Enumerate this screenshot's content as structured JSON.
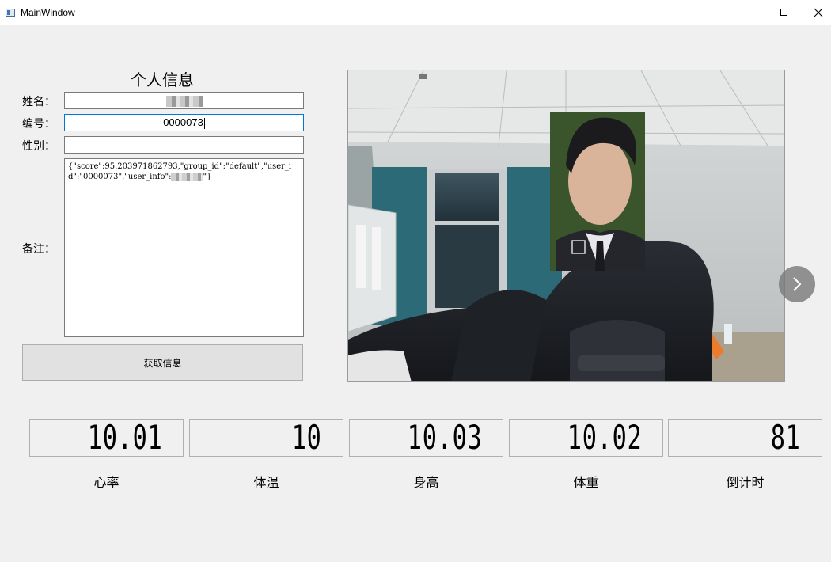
{
  "window": {
    "title": "MainWindow"
  },
  "form": {
    "title": "个人信息",
    "name_label": "姓名：",
    "id_label": "编号：",
    "id_value": "0000073",
    "gender_label": "性别：",
    "gender_value": "",
    "notes_label": "备注：",
    "notes_text_part1": "{\"score\":95.203971862793,\"group_id\":\"default\",\"user_id\":\"0000073\",\"user_info\":",
    "notes_text_part2": "\"}",
    "get_button": "获取信息"
  },
  "metrics": [
    {
      "label": "心率",
      "value": "10.01"
    },
    {
      "label": "体温",
      "value": "10"
    },
    {
      "label": "身高",
      "value": "10.03"
    },
    {
      "label": "体重",
      "value": "10.02"
    },
    {
      "label": "倒计时",
      "value": "81"
    }
  ],
  "icons": {
    "app": "app-window-icon",
    "minimize": "minimize-icon",
    "maximize": "maximize-icon",
    "close": "close-icon",
    "next": "chevron-right-icon"
  }
}
